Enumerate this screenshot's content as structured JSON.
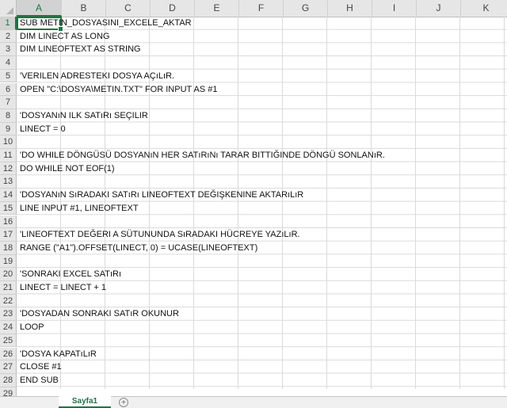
{
  "columns": [
    "A",
    "B",
    "C",
    "D",
    "E",
    "F",
    "G",
    "H",
    "I",
    "J",
    "K"
  ],
  "active_column": "A",
  "active_row": 1,
  "rows": [
    {
      "n": "1",
      "text": "SUB METIN_DOSYASINI_EXCELE_AKTAR"
    },
    {
      "n": "2",
      "text": "DIM LINECT AS LONG"
    },
    {
      "n": "3",
      "text": "DIM LINEOFTEXT AS STRING"
    },
    {
      "n": "4",
      "text": ""
    },
    {
      "n": "5",
      "text": "'VERILEN ADRESTEKI DOSYA AÇıLıR."
    },
    {
      "n": "6",
      "text": "OPEN \"C:\\DOSYA\\METIN.TXT\" FOR INPUT AS #1"
    },
    {
      "n": "7",
      "text": ""
    },
    {
      "n": "8",
      "text": "'DOSYANıN ILK SATıRı SEÇILIR"
    },
    {
      "n": "9",
      "text": "LINECT = 0"
    },
    {
      "n": "10",
      "text": ""
    },
    {
      "n": "11",
      "text": "'DO WHILE DÖNGÜSÜ DOSYANıN HER SATıRıNı TARAR BITTIĞINDE DÖNGÜ SONLANıR."
    },
    {
      "n": "12",
      "text": "DO WHILE NOT EOF(1)"
    },
    {
      "n": "13",
      "text": ""
    },
    {
      "n": "14",
      "text": "'DOSYANıN SıRADAKI SATıRı LINEOFTEXT DEĞIŞKENINE AKTARıLıR"
    },
    {
      "n": "15",
      "text": "LINE INPUT #1, LINEOFTEXT"
    },
    {
      "n": "16",
      "text": ""
    },
    {
      "n": "17",
      "text": "'LINEOFTEXT DEĞERI A SÜTUNUNDA SıRADAKI HÜCREYE YAZıLıR."
    },
    {
      "n": "18",
      "text": "RANGE (\"A1\").OFFSET(LINECT, 0) = UCASE(LINEOFTEXT)"
    },
    {
      "n": "19",
      "text": ""
    },
    {
      "n": "20",
      "text": "'SONRAKI EXCEL SATıRı"
    },
    {
      "n": "21",
      "text": "LINECT = LINECT + 1"
    },
    {
      "n": "22",
      "text": ""
    },
    {
      "n": "23",
      "text": "'DOSYADAN SONRAKI SATıR OKUNUR"
    },
    {
      "n": "24",
      "text": "LOOP"
    },
    {
      "n": "25",
      "text": ""
    },
    {
      "n": "26",
      "text": "'DOSYA KAPATıLıR"
    },
    {
      "n": "27",
      "text": "CLOSE #1"
    },
    {
      "n": "28",
      "text": "END SUB"
    },
    {
      "n": "29",
      "text": ""
    }
  ],
  "sheet_tab": {
    "label": "Sayfa1"
  },
  "add_sheet_symbol": "+",
  "colors": {
    "accent": "#217346",
    "header_bg": "#e6e6e6",
    "gridline": "#dadada"
  }
}
